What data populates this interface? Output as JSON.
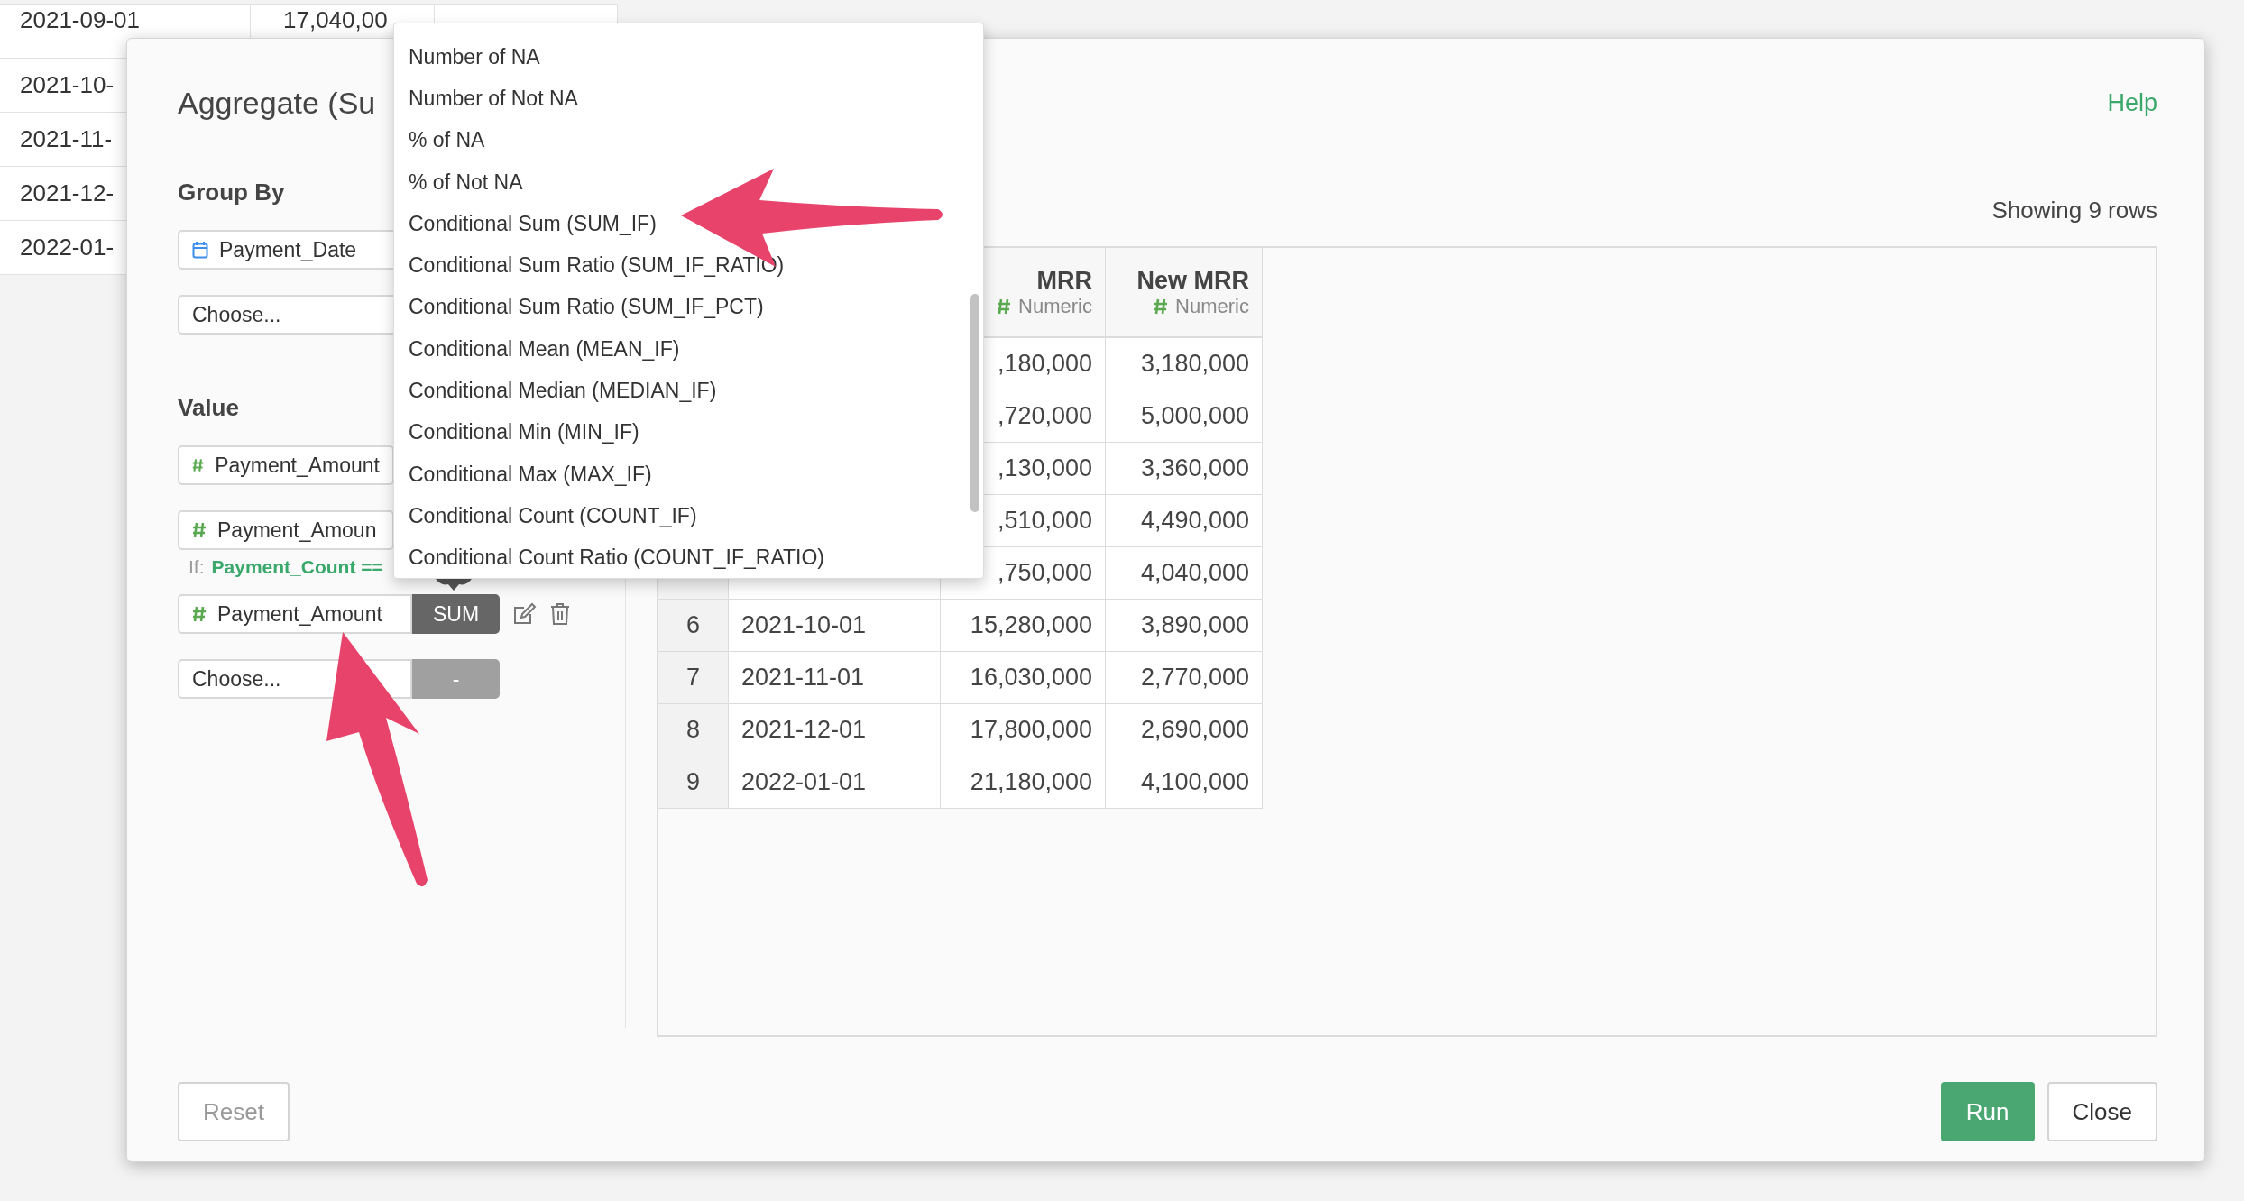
{
  "background_table": {
    "rows": [
      {
        "column_1": "2021-09-01",
        "column_2": "17,040,00"
      },
      {
        "column_1": "2021-10-"
      },
      {
        "column_1": "2021-11-"
      },
      {
        "column_1": "2021-12-"
      },
      {
        "column_1": "2022-01-"
      }
    ]
  },
  "dialog": {
    "title": "Aggregate (Su",
    "help_link": "Help",
    "group_by": {
      "label": "Group By",
      "fields": [
        {
          "kind": "date_column",
          "value": "Payment_Date"
        },
        {
          "kind": "empty",
          "placeholder": "Choose..."
        }
      ]
    },
    "value": {
      "label": "Value",
      "fields": [
        {
          "kind": "numeric_column",
          "value": "Payment_Amount"
        },
        {
          "kind": "numeric_column",
          "value": "Payment_Amoun",
          "condition_label": "If:",
          "condition": "Payment_Count =="
        },
        {
          "kind": "numeric_column",
          "value": "Payment_Amount",
          "function": {
            "label": "SUM",
            "disabled": false
          }
        },
        {
          "kind": "empty",
          "placeholder": "Choose...",
          "function": {
            "label": "-",
            "disabled": true
          }
        }
      ]
    },
    "row_count": "Showing 9 rows",
    "table": {
      "columns": [
        {
          "label": "MRR",
          "type": "Numeric"
        },
        {
          "label": "New MRR",
          "type": "Numeric"
        }
      ],
      "rows": [
        {
          "mrr": ",180,000",
          "new_mrr": "3,180,000"
        },
        {
          "mrr": ",720,000",
          "new_mrr": "5,000,000"
        },
        {
          "mrr": ",130,000",
          "new_mrr": "3,360,000"
        },
        {
          "mrr": ",510,000",
          "new_mrr": "4,490,000"
        },
        {
          "mrr": ",750,000",
          "new_mrr": "4,040,000"
        },
        {
          "column_1": "6",
          "column_2": "2021-10-01",
          "mrr": "15,280,000",
          "new_mrr": "3,890,000"
        },
        {
          "column_1": "7",
          "column_2": "2021-11-01",
          "mrr": "16,030,000",
          "new_mrr": "2,770,000"
        },
        {
          "column_1": "8",
          "column_2": "2021-12-01",
          "mrr": "17,800,000",
          "new_mrr": "2,690,000"
        },
        {
          "column_1": "9",
          "column_2": "2022-01-01",
          "mrr": "21,180,000",
          "new_mrr": "4,100,000"
        }
      ]
    },
    "buttons": {
      "reset": "Reset",
      "run": "Run",
      "close": "Close"
    },
    "dropdown": {
      "items": [
        "Number of NA",
        "Number of Not NA",
        "% of NA",
        "% of Not NA",
        "Conditional Sum (SUM_IF)",
        "Conditional Sum Ratio (SUM_IF_RATIO)",
        "Conditional Sum Ratio (SUM_IF_PCT)",
        "Conditional Mean (MEAN_IF)",
        "Conditional Median (MEDIAN_IF)",
        "Conditional Min (MIN_IF)",
        "Conditional Max (MAX_IF)",
        "Conditional Count (COUNT_IF)",
        "Conditional Count Ratio (COUNT_IF_RATIO)"
      ]
    }
  }
}
